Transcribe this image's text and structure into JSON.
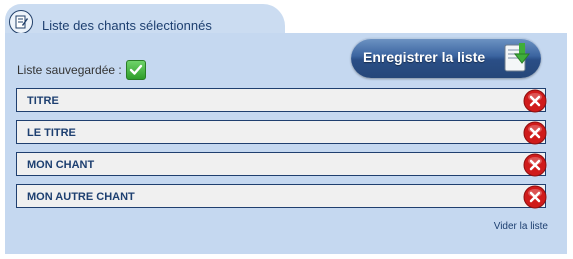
{
  "tab": {
    "title": "Liste des chants sélectionnés",
    "icon": "document-edit-icon"
  },
  "status": {
    "label": "Liste sauvegardée :",
    "icon": "checkmark-icon"
  },
  "save_button": {
    "label": "Enregistrer la liste",
    "icon": "download-save-icon"
  },
  "songs": [
    {
      "title": "TITRE"
    },
    {
      "title": "LE TITRE"
    },
    {
      "title": "MON CHANT"
    },
    {
      "title": "MON AUTRE CHANT"
    }
  ],
  "clear_link": {
    "label": "Vider la liste"
  },
  "colors": {
    "panel": "#c5d8f0",
    "title_text": "#1d3f70",
    "delete_red": "#d01b1b",
    "button_blue": "#2a4e86"
  }
}
